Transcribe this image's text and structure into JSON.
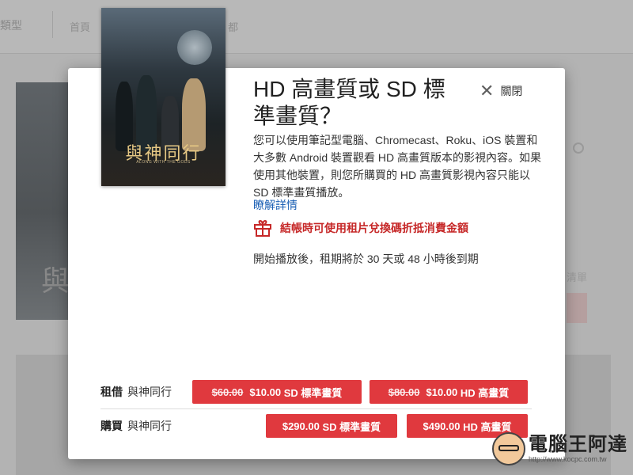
{
  "background": {
    "nav_type": "類型",
    "nav_home": "首頁",
    "nav_extra": "都",
    "poster_char": "與",
    "side_text": "清單"
  },
  "movie": {
    "cover_title": "與神同行",
    "cover_subtitle": "ALONG WITH THE GODS"
  },
  "modal": {
    "title": "HD 高畫質或 SD 標準畫質？",
    "close_label": "關閉",
    "description": "您可以使用筆記型電腦、Chromecast、Roku、iOS 裝置和大多數 Android 裝置觀看 HD 高畫質版本的影視內容。如果使用其他裝置，則您所購買的 HD 高畫質影視內容只能以 SD 標準畫質播放。",
    "learn_more": "瞭解詳情",
    "promo": "結帳時可使用租片兌換碼折抵消費金額",
    "rental_note": "開始播放後，租期將於 30 天或 48 小時後到期"
  },
  "offers": {
    "rent": {
      "label": "租借",
      "title": "與神同行",
      "sd": {
        "old": "$60.00",
        "price": "$10.00",
        "quality": "SD 標準畫質"
      },
      "hd": {
        "old": "$80.00",
        "price": "$10.00",
        "quality": "HD 高畫質"
      }
    },
    "buy": {
      "label": "購買",
      "title": "與神同行",
      "sd": {
        "price": "$290.00",
        "quality": "SD 標準畫質"
      },
      "hd": {
        "price": "$490.00",
        "quality": "HD 高畫質"
      }
    }
  },
  "watermark": {
    "name": "電腦王阿達",
    "url": "http://www.kocpc.com.tw"
  },
  "colors": {
    "accent_red": "#e0393e",
    "promo_red": "#c62828",
    "link_blue": "#1a5fb4"
  }
}
